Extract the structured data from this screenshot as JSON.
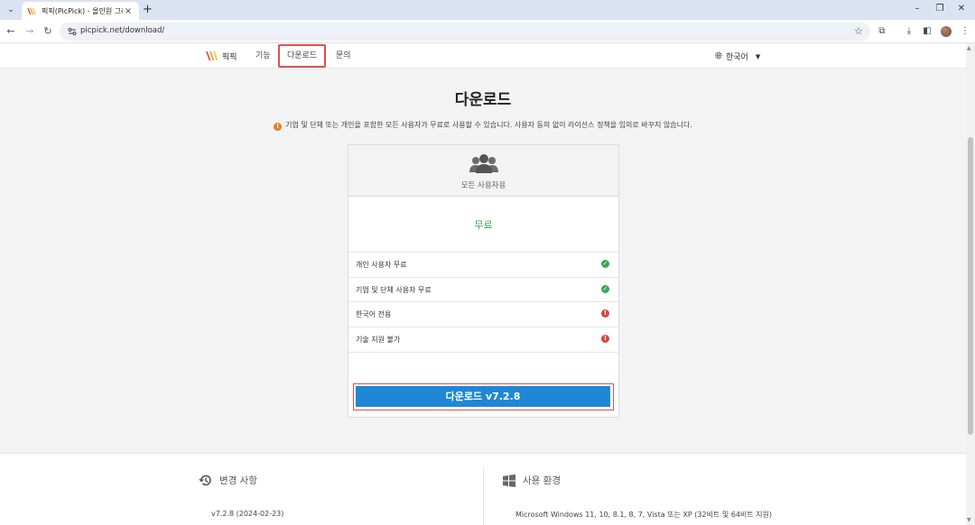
{
  "browser": {
    "tab_title": "픽픽(PicPick) - 올인원 그래픽",
    "url": "picpick.net/download/"
  },
  "site": {
    "logo_text": "픽픽",
    "nav": [
      {
        "label": "기능"
      },
      {
        "label": "다운로드"
      },
      {
        "label": "문의"
      }
    ],
    "language": "한국어"
  },
  "main": {
    "title": "다운로드",
    "notice": "기업 및 단체 또는 개인을 포함한 모든 사용자가 무료로 사용할 수 있습니다. 사용자 동의 없이 라이선스 정책을 임의로 바꾸지 않습니다."
  },
  "plan": {
    "audience": "모든 사용자용",
    "price": "무료",
    "features": [
      {
        "label": "개인 사용자 무료",
        "status": "ok"
      },
      {
        "label": "기업 및 단체 사용자 무료",
        "status": "ok"
      },
      {
        "label": "한국어 전용",
        "status": "no"
      },
      {
        "label": "기술 지원 불가",
        "status": "no"
      }
    ],
    "download_label": "다운로드 v7.2.8"
  },
  "footer": {
    "changelog_title": "변경 사항",
    "changelog_value": "v7.2.8 (2024-02-23)",
    "env_title": "사용 환경",
    "env_value": "Microsoft Windows 11, 10, 8.1, 8, 7, Vista 또는 XP (32비트 및 64비트 지원)"
  },
  "colors": {
    "accent_blue": "#1f87d6",
    "highlight_red": "#d9534f",
    "free_green": "#3e9c4e"
  }
}
